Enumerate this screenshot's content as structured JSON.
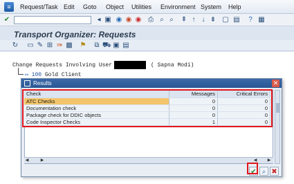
{
  "menu": {
    "items": [
      "Request/Task",
      "Edit",
      "Goto",
      "Object",
      "Utilities",
      "Environment",
      "System",
      "Help"
    ]
  },
  "header": {
    "title": "Transport Organizer: Requests"
  },
  "tree": {
    "header_label": "Change Requests Involving User",
    "user_name_suffix": "( Sapna Modi)",
    "client_number": "100",
    "client_label": "Gold Client"
  },
  "dialog": {
    "title": "Results",
    "columns": [
      "Check",
      "Messages",
      "Critical Errors"
    ],
    "rows": [
      {
        "check": "ATC Checks",
        "messages": "0",
        "critical_errors": "0"
      },
      {
        "check": "Documentation check",
        "messages": "0",
        "critical_errors": "0"
      },
      {
        "check": "Package check for DDIC objects",
        "messages": "0",
        "critical_errors": "0"
      },
      {
        "check": "Code Inspector Checks",
        "messages": "1",
        "critical_errors": "0"
      }
    ],
    "selected_row": 0
  },
  "colors": {
    "highlight": "#e0161b",
    "title_bar": "#2a5794",
    "selected_cell": "#f3c56a"
  }
}
